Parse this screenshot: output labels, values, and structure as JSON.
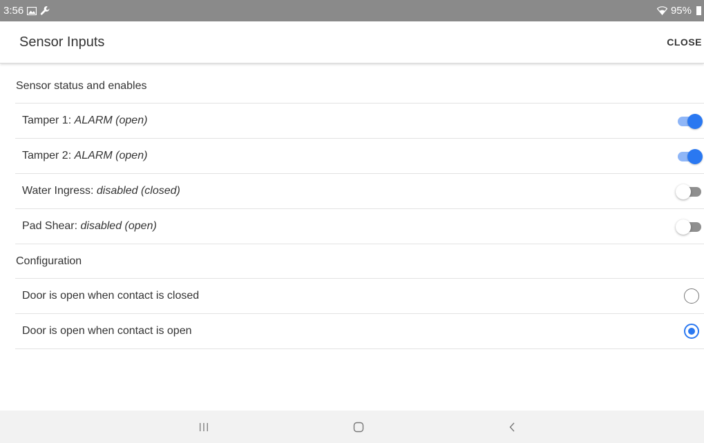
{
  "status_bar": {
    "time": "3:56",
    "battery": "95%",
    "icons": [
      "gallery-icon",
      "wrench-icon",
      "wifi-icon",
      "battery-icon"
    ]
  },
  "app_bar": {
    "title": "Sensor Inputs",
    "close_label": "CLOSE"
  },
  "sensor_section": {
    "header": "Sensor status and enables",
    "rows": [
      {
        "name": "Tamper 1: ",
        "status": "ALARM (open)",
        "enabled": true
      },
      {
        "name": "Tamper 2: ",
        "status": "ALARM (open)",
        "enabled": true
      },
      {
        "name": "Water Ingress: ",
        "status": "disabled (closed)",
        "enabled": false
      },
      {
        "name": "Pad Shear: ",
        "status": "disabled (open)",
        "enabled": false
      }
    ]
  },
  "config_section": {
    "header": "Configuration",
    "options": [
      {
        "label": "Door is open when contact is closed",
        "selected": false
      },
      {
        "label": "Door is open when contact is open",
        "selected": true
      }
    ]
  },
  "nav_bar": {
    "icons": [
      "recent-apps-icon",
      "home-icon",
      "back-icon"
    ]
  },
  "colors": {
    "accent": "#2a78f1",
    "accent_track": "#8fb6f7",
    "status_bar": "#8a8a8a",
    "nav_bar": "#f2f2f2"
  }
}
